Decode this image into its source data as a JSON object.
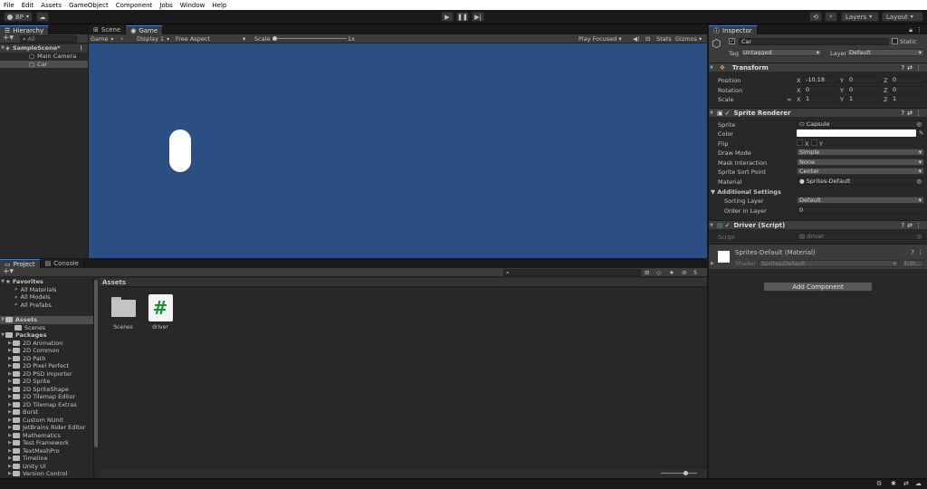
{
  "menu": [
    "File",
    "Edit",
    "Assets",
    "GameObject",
    "Component",
    "Jobs",
    "Window",
    "Help"
  ],
  "toolbar": {
    "account": "BP",
    "layers": "Layers",
    "layout": "Layout"
  },
  "hierarchy": {
    "tab": "Hierarchy",
    "search_placeholder": "All",
    "scene": "SampleScene*",
    "items": [
      "Main Camera",
      "Car"
    ]
  },
  "scene_tabs": [
    "Scene",
    "Game"
  ],
  "game_bar": {
    "mode": "Game",
    "display": "Display 1",
    "aspect": "Free Aspect",
    "scale_label": "Scale",
    "scale_value": "1x",
    "play_focused": "Play Focused",
    "stats": "Stats",
    "gizmos": "Gizmos"
  },
  "project": {
    "tabs": [
      "Project",
      "Console"
    ],
    "favorites_title": "Favorites",
    "favorites": [
      "All Materials",
      "All Models",
      "All Prefabs"
    ],
    "assets_title": "Assets",
    "assets_children": [
      "Scenes"
    ],
    "packages_title": "Packages",
    "packages": [
      "2D Animation",
      "2D Common",
      "2D Path",
      "2D Pixel Perfect",
      "2D PSD Importer",
      "2D Sprite",
      "2D SpriteShape",
      "2D Tilemap Editor",
      "2D Tilemap Extras",
      "Burst",
      "Custom NUnit",
      "JetBrains Rider Editor",
      "Mathematics",
      "Test Framework",
      "TextMeshPro",
      "Timeline",
      "Unity UI",
      "Version Control"
    ],
    "breadcrumb": "Assets",
    "grid": [
      {
        "name": "Scenes",
        "icon": "folder-icon"
      },
      {
        "name": "driver",
        "icon": "csharp-script-icon"
      }
    ],
    "count": "5"
  },
  "inspector": {
    "tab": "Inspector",
    "object_name": "Car",
    "static_label": "Static",
    "tag_label": "Tag",
    "tag": "Untagged",
    "layer_label": "Layer",
    "layer": "Default",
    "transform": {
      "title": "Transform",
      "rows": [
        {
          "label": "Position",
          "x": "-10.18",
          "y": "0",
          "z": "0"
        },
        {
          "label": "Rotation",
          "x": "0",
          "y": "0",
          "z": "0"
        },
        {
          "label": "Scale",
          "x": "1",
          "y": "1",
          "z": "1"
        }
      ]
    },
    "sprite_renderer": {
      "title": "Sprite Renderer",
      "sprite_label": "Sprite",
      "sprite": "Capsule",
      "color_label": "Color",
      "color": "#ffffff",
      "flip_label": "Flip",
      "flip_x": "X",
      "flip_y": "Y",
      "draw_mode_label": "Draw Mode",
      "draw_mode": "Simple",
      "mask_label": "Mask Interaction",
      "mask": "None",
      "sort_point_label": "Sprite Sort Point",
      "sort_point": "Center",
      "material_label": "Material",
      "material": "Sprites-Default",
      "additional": "Additional Settings",
      "sorting_layer_label": "Sorting Layer",
      "sorting_layer": "Default",
      "order_label": "Order in Layer",
      "order": "0"
    },
    "driver": {
      "title": "Driver (Script)",
      "script_label": "Script",
      "script": "driver"
    },
    "material": {
      "name": "Sprites-Default (Material)",
      "shader_label": "Shader",
      "shader": "Sprites/Default",
      "edit": "Edit..."
    },
    "add_component": "Add Component"
  },
  "colors": {
    "game_bg": "#2c4f83",
    "accent": "#3a79bb",
    "panel": "#282828",
    "toolbar": "#191919"
  }
}
